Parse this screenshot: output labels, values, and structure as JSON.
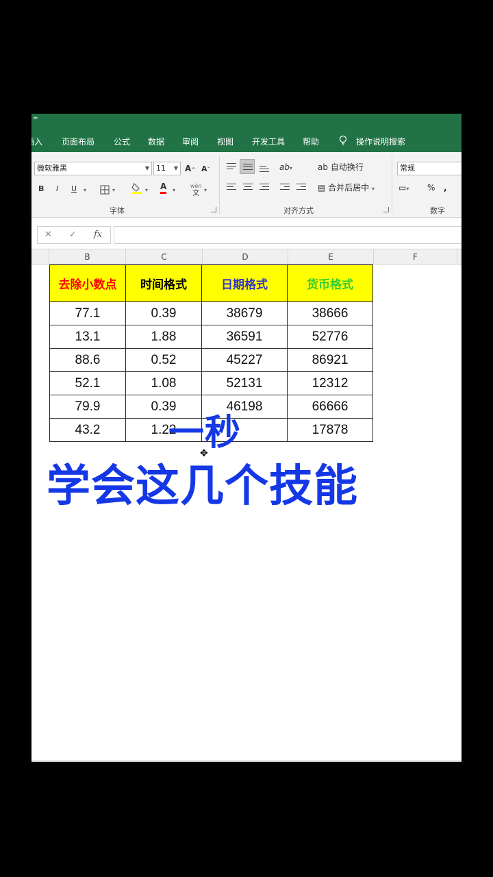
{
  "qat_glyph": "=",
  "menu": [
    "插入",
    "页面布局",
    "公式",
    "数据",
    "审阅",
    "视图",
    "开发工具",
    "帮助",
    "操作说明搜索"
  ],
  "ribbon": {
    "font_name": "微软雅黑",
    "font_size": "11",
    "bold": "B",
    "italic": "I",
    "underline": "U",
    "grow_font": "A",
    "shrink_font": "A",
    "font_color": "A",
    "phonetic": "文",
    "wrap_text": "自动换行",
    "merge_center": "合并后居中",
    "number_format": "常规",
    "percent": "%",
    "comma": ",",
    "groups": {
      "font": "字体",
      "alignment": "对齐方式",
      "number": "数字"
    }
  },
  "formula_bar": {
    "cancel": "✕",
    "enter": "✓",
    "fx": "fx",
    "value": ""
  },
  "columns": [
    "B",
    "C",
    "D",
    "E",
    "F"
  ],
  "table": {
    "headers": [
      {
        "label": "去除小数点",
        "color": "#ff0000"
      },
      {
        "label": "时间格式",
        "color": "#000000"
      },
      {
        "label": "日期格式",
        "color": "#3333cc"
      },
      {
        "label": "货币格式",
        "color": "#33cc33"
      }
    ],
    "rows": [
      [
        "77.1",
        "0.39",
        "38679",
        "38666"
      ],
      [
        "13.1",
        "1.88",
        "36591",
        "52776"
      ],
      [
        "88.6",
        "0.52",
        "45227",
        "86921"
      ],
      [
        "52.1",
        "1.08",
        "52131",
        "12312"
      ],
      [
        "79.9",
        "0.39",
        "46198",
        "66666"
      ],
      [
        "43.2",
        "1.22",
        "",
        "17878"
      ]
    ]
  },
  "caption": {
    "line1": "一秒",
    "line2": "学会这几个技能",
    "color": "#1538e6"
  },
  "colors": {
    "excel_green": "#217346",
    "header_fill": "#ffff00"
  }
}
